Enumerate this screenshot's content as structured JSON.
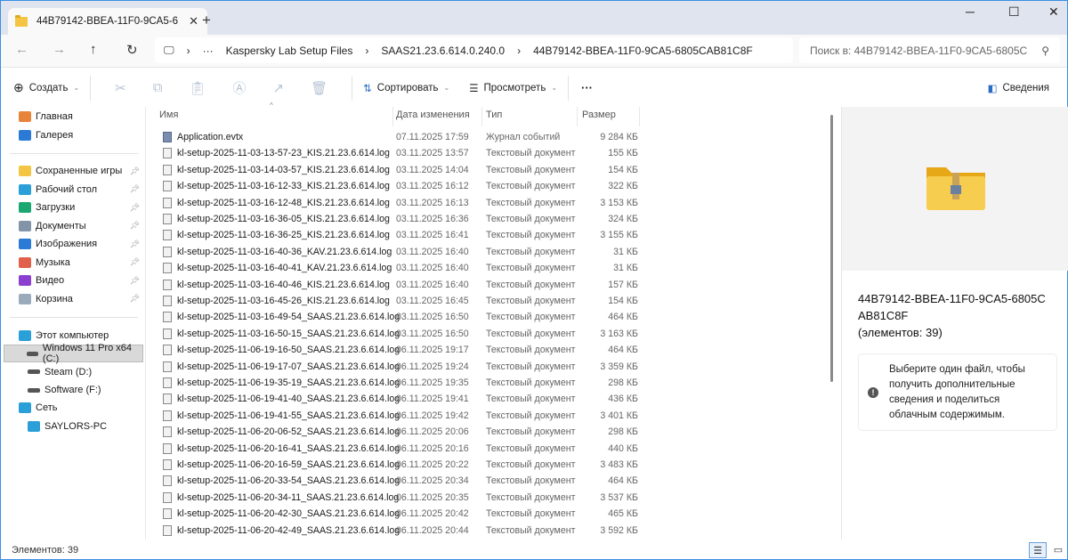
{
  "window": {
    "tab_title": "44B79142-BBEA-11F0-9CA5-6",
    "new_tab": "+",
    "minimize": "─",
    "maximize": "☐",
    "close": "✕"
  },
  "address": {
    "crumbs": [
      "Kaspersky Lab Setup Files",
      "SAAS21.23.6.614.0.240.0",
      "44B79142-BBEA-11F0-9CA5-6805CAB81C8F"
    ],
    "ellipsis": "···",
    "search_placeholder": "Поиск в: 44B79142-BBEA-11F0-9CA5-6805C"
  },
  "toolbar": {
    "create": "Создать",
    "sort": "Сортировать",
    "view": "Просмотреть",
    "more": "···",
    "details": "Сведения"
  },
  "sidebar": {
    "quick": [
      {
        "label": "Главная",
        "color": "#e8833a"
      },
      {
        "label": "Галерея",
        "color": "#2b7bd6"
      }
    ],
    "pinned": [
      {
        "label": "Сохраненные игры",
        "color": "#f4c542"
      },
      {
        "label": "Рабочий стол",
        "color": "#2a9fd8"
      },
      {
        "label": "Загрузки",
        "color": "#1aa870"
      },
      {
        "label": "Документы",
        "color": "#8494a8"
      },
      {
        "label": "Изображения",
        "color": "#2b7bd6"
      },
      {
        "label": "Музыка",
        "color": "#e0604a"
      },
      {
        "label": "Видео",
        "color": "#8a3fd1"
      },
      {
        "label": "Корзина",
        "color": "#9ab"
      }
    ],
    "computer": {
      "label": "Этот компьютер",
      "drives": [
        "Windows 11 Pro x64 (C:)",
        "Steam (D:)",
        "Software (F:)"
      ]
    },
    "network": {
      "label": "Сеть",
      "hosts": [
        "SAYLORS-PC"
      ]
    }
  },
  "columns": {
    "name": "Имя",
    "date": "Дата изменения",
    "type": "Тип",
    "size": "Размер"
  },
  "files": [
    [
      "Application.evtx",
      "07.11.2025 17:59",
      "Журнал событий",
      "9 284 КБ"
    ],
    [
      "kl-setup-2025-11-03-13-57-23_KIS.21.23.6.614.log",
      "03.11.2025 13:57",
      "Текстовый документ",
      "155 КБ"
    ],
    [
      "kl-setup-2025-11-03-14-03-57_KIS.21.23.6.614.log",
      "03.11.2025 14:04",
      "Текстовый документ",
      "154 КБ"
    ],
    [
      "kl-setup-2025-11-03-16-12-33_KIS.21.23.6.614.log",
      "03.11.2025 16:12",
      "Текстовый документ",
      "322 КБ"
    ],
    [
      "kl-setup-2025-11-03-16-12-48_KIS.21.23.6.614.log",
      "03.11.2025 16:13",
      "Текстовый документ",
      "3 153 КБ"
    ],
    [
      "kl-setup-2025-11-03-16-36-05_KIS.21.23.6.614.log",
      "03.11.2025 16:36",
      "Текстовый документ",
      "324 КБ"
    ],
    [
      "kl-setup-2025-11-03-16-36-25_KIS.21.23.6.614.log",
      "03.11.2025 16:41",
      "Текстовый документ",
      "3 155 КБ"
    ],
    [
      "kl-setup-2025-11-03-16-40-36_KAV.21.23.6.614.log",
      "03.11.2025 16:40",
      "Текстовый документ",
      "31 КБ"
    ],
    [
      "kl-setup-2025-11-03-16-40-41_KAV.21.23.6.614.log",
      "03.11.2025 16:40",
      "Текстовый документ",
      "31 КБ"
    ],
    [
      "kl-setup-2025-11-03-16-40-46_KIS.21.23.6.614.log",
      "03.11.2025 16:40",
      "Текстовый документ",
      "157 КБ"
    ],
    [
      "kl-setup-2025-11-03-16-45-26_KIS.21.23.6.614.log",
      "03.11.2025 16:45",
      "Текстовый документ",
      "154 КБ"
    ],
    [
      "kl-setup-2025-11-03-16-49-54_SAAS.21.23.6.614.log",
      "03.11.2025 16:50",
      "Текстовый документ",
      "464 КБ"
    ],
    [
      "kl-setup-2025-11-03-16-50-15_SAAS.21.23.6.614.log",
      "03.11.2025 16:50",
      "Текстовый документ",
      "3 163 КБ"
    ],
    [
      "kl-setup-2025-11-06-19-16-50_SAAS.21.23.6.614.log",
      "06.11.2025 19:17",
      "Текстовый документ",
      "464 КБ"
    ],
    [
      "kl-setup-2025-11-06-19-17-07_SAAS.21.23.6.614.log",
      "06.11.2025 19:24",
      "Текстовый документ",
      "3 359 КБ"
    ],
    [
      "kl-setup-2025-11-06-19-35-19_SAAS.21.23.6.614.log",
      "06.11.2025 19:35",
      "Текстовый документ",
      "298 КБ"
    ],
    [
      "kl-setup-2025-11-06-19-41-40_SAAS.21.23.6.614.log",
      "06.11.2025 19:41",
      "Текстовый документ",
      "436 КБ"
    ],
    [
      "kl-setup-2025-11-06-19-41-55_SAAS.21.23.6.614.log",
      "06.11.2025 19:42",
      "Текстовый документ",
      "3 401 КБ"
    ],
    [
      "kl-setup-2025-11-06-20-06-52_SAAS.21.23.6.614.log",
      "06.11.2025 20:06",
      "Текстовый документ",
      "298 КБ"
    ],
    [
      "kl-setup-2025-11-06-20-16-41_SAAS.21.23.6.614.log",
      "06.11.2025 20:16",
      "Текстовый документ",
      "440 КБ"
    ],
    [
      "kl-setup-2025-11-06-20-16-59_SAAS.21.23.6.614.log",
      "06.11.2025 20:22",
      "Текстовый документ",
      "3 483 КБ"
    ],
    [
      "kl-setup-2025-11-06-20-33-54_SAAS.21.23.6.614.log",
      "06.11.2025 20:34",
      "Текстовый документ",
      "464 КБ"
    ],
    [
      "kl-setup-2025-11-06-20-34-11_SAAS.21.23.6.614.log",
      "06.11.2025 20:35",
      "Текстовый документ",
      "3 537 КБ"
    ],
    [
      "kl-setup-2025-11-06-20-42-30_SAAS.21.23.6.614.log",
      "06.11.2025 20:42",
      "Текстовый документ",
      "465 КБ"
    ],
    [
      "kl-setup-2025-11-06-20-42-49_SAAS.21.23.6.614.log",
      "06.11.2025 20:44",
      "Текстовый документ",
      "3 592 КБ"
    ]
  ],
  "details": {
    "title": "44B79142-BBEA-11F0-9CA5-6805CAB81C8F",
    "count": "(элементов: 39)",
    "info": "Выберите один файл, чтобы получить дополнительные сведения и поделиться облачным содержимым."
  },
  "status": {
    "items": "Элементов: 39"
  }
}
